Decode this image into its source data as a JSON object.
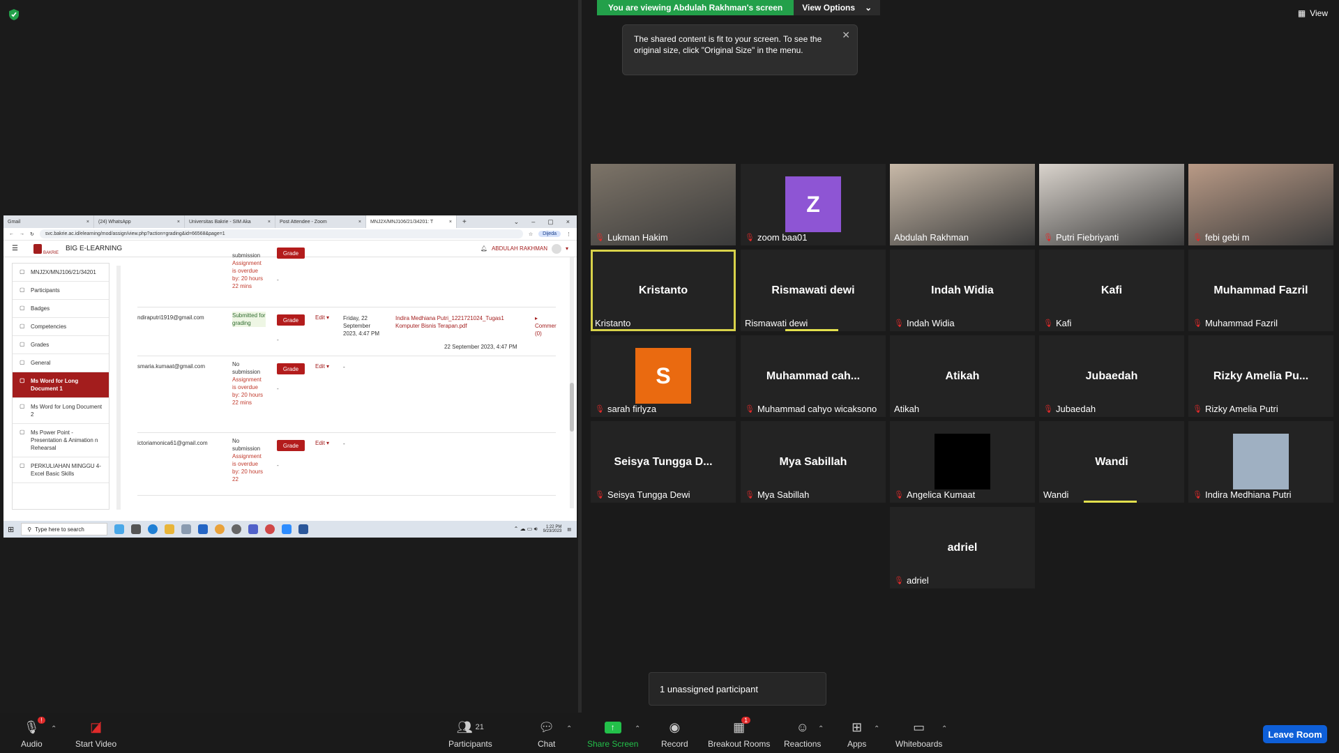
{
  "banner": {
    "viewing": "You are viewing Abdulah Rakhman's screen",
    "view_options": "View Options"
  },
  "tooltip": {
    "text": "The shared content is fit to your screen. To see the original size, click \"Original Size\" in the menu."
  },
  "top_right": {
    "view_label": "View"
  },
  "shared_screen": {
    "tabs": [
      "Gmail",
      "(24) WhatsApp",
      "Universitas Bakrie - SIM Aka",
      "Post Attendee - Zoom",
      "MNJ2X/MNJ106/21/34201: T"
    ],
    "url": "svc.bakrie.ac.id/elearning/mod/assign/view.php?action=grading&id=66568&page=1",
    "profile_chip": "Dijeda",
    "site_name": "BIG E-LEARNING",
    "logo_text": "BAKRIE",
    "user_name": "ABDULAH RAKHMAN",
    "sidebar": [
      {
        "label": "MNJ2X/MNJ106/21/34201",
        "active": false
      },
      {
        "label": "Participants",
        "active": false
      },
      {
        "label": "Badges",
        "active": false
      },
      {
        "label": "Competencies",
        "active": false
      },
      {
        "label": "Grades",
        "active": false
      },
      {
        "label": "General",
        "active": false
      },
      {
        "label": "Ms Word for Long Document 1",
        "active": true
      },
      {
        "label": "Ms Word for Long Document 2",
        "active": false
      },
      {
        "label": "Ms Power Point - Presentation & Animation n Rehearsal",
        "active": false
      },
      {
        "label": "PERKULIAHAN MINGGU 4- Excel Basic Skills",
        "active": false
      }
    ],
    "rows": [
      {
        "email": "",
        "status": "submission",
        "overdue": "Assignment is overdue by: 20 hours 22 mins",
        "grade": "Grade",
        "edit": "",
        "date": "",
        "file": "",
        "ts": "",
        "comm": "",
        "dash": "-"
      },
      {
        "email": "ndiraputri1919@gmail.com",
        "status": "Submitted for grading",
        "overdue": "",
        "grade": "Grade",
        "edit": "Edit ▾",
        "date": "Friday, 22 September 2023, 4:47 PM",
        "file": "Indira Medhiana Putri_1221721024_Tugas1 Komputer Bisnis Terapan.pdf",
        "ts": "22 September 2023, 4:47 PM",
        "comm": "▸ Commer (0)",
        "dash": "-"
      },
      {
        "email": "smaria.kumaat@gmail.com",
        "status": "No submission",
        "overdue": "Assignment is overdue by: 20 hours 22 mins",
        "grade": "Grade",
        "edit": "Edit ▾",
        "date": "-",
        "file": "",
        "ts": "",
        "comm": "",
        "dash": "-"
      },
      {
        "email": "ictoriamonica61@gmail.com",
        "status": "No submission",
        "overdue": "Assignment is overdue by: 20 hours 22",
        "grade": "Grade",
        "edit": "Edit ▾",
        "date": "-",
        "file": "",
        "ts": "",
        "comm": "",
        "dash": "-"
      }
    ],
    "taskbar": {
      "search_placeholder": "Type here to search",
      "time": "1:22 PM",
      "date": "9/23/2023"
    }
  },
  "participants": [
    {
      "name": "Lukman Hakim",
      "muted": true,
      "type": "video",
      "color": "#7d7468"
    },
    {
      "name": "zoom baa01",
      "muted": true,
      "type": "avatar",
      "letter": "Z",
      "color": "#8e55d4"
    },
    {
      "name": "Abdulah Rakhman",
      "muted": false,
      "type": "video",
      "color": "#c8b9a8"
    },
    {
      "name": "Putri Fiebriyanti",
      "muted": true,
      "type": "video",
      "color": "#d9d3cc"
    },
    {
      "name": "febi gebi m",
      "muted": true,
      "type": "video",
      "color": "#b99a86"
    },
    {
      "name": "Kristanto",
      "display": "Kristanto",
      "muted": false,
      "type": "name",
      "active_speaker": true
    },
    {
      "name": "Rismawati dewi",
      "display": "Rismawati dewi",
      "muted": false,
      "type": "name",
      "speaking": true
    },
    {
      "name": "Indah Widia",
      "display": "Indah Widia",
      "muted": true,
      "type": "name"
    },
    {
      "name": "Kafi",
      "display": "Kafi",
      "muted": true,
      "type": "name"
    },
    {
      "name": "Muhammad Fazril",
      "display": "Muhammad Fazril",
      "muted": true,
      "type": "name"
    },
    {
      "name": "sarah firlyza",
      "muted": true,
      "type": "avatar",
      "letter": "S",
      "color": "#ea6a10"
    },
    {
      "name": "Muhammad cahyo wicaksono",
      "display": "Muhammad cah...",
      "muted": true,
      "type": "name"
    },
    {
      "name": "Atikah",
      "display": "Atikah",
      "muted": false,
      "type": "name"
    },
    {
      "name": "Jubaedah",
      "display": "Jubaedah",
      "muted": true,
      "type": "name"
    },
    {
      "name": "Rizky Amelia Putri",
      "display": "Rizky Amelia Pu...",
      "muted": true,
      "type": "name"
    },
    {
      "name": "Seisya Tungga Dewi",
      "display": "Seisya Tungga D...",
      "muted": true,
      "type": "name"
    },
    {
      "name": "Mya Sabillah",
      "display": "Mya Sabillah",
      "muted": true,
      "type": "name"
    },
    {
      "name": "Angelica Kumaat",
      "muted": true,
      "type": "avatar",
      "letter": "",
      "color": "#000000"
    },
    {
      "name": "Wandi",
      "display": "Wandi",
      "muted": false,
      "type": "name",
      "speaking": true
    },
    {
      "name": "Indira Medhiana Putri",
      "muted": true,
      "type": "avatar",
      "letter": "",
      "color": "#9fb0c2"
    },
    {
      "name": "adriel",
      "display": "adriel",
      "muted": true,
      "type": "name"
    }
  ],
  "unassigned": "1 unassigned participant",
  "toolbar": {
    "audio": "Audio",
    "audio_badge": "!",
    "start_video": "Start Video",
    "participants": "Participants",
    "participants_count": "21",
    "chat": "Chat",
    "share_screen": "Share Screen",
    "record": "Record",
    "breakout": "Breakout Rooms",
    "breakout_badge": "1",
    "reactions": "Reactions",
    "apps": "Apps",
    "whiteboards": "Whiteboards",
    "leave": "Leave Room"
  }
}
